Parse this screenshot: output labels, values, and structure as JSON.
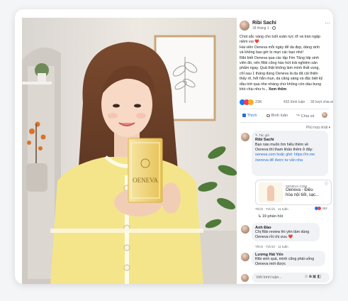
{
  "post": {
    "author": "Ribi Sachi",
    "meta": "18 tháng 1 · ",
    "caption_lines": [
      "Chút sắc vàng cho tuổi xuân rực rỡ và tràn ngập",
      "niềm vui ❤️",
      "Hai viên Oeneva mỗi ngày để da đẹp, dáng xinh",
      "và không bao giờ lo mụn các bạn nhé!",
      "Ribi biết Oeneva qua các tập Fim Tăng Idp sinh",
      "viên đó, nên Ribi cũng hào hứt trải nghiệm sản",
      "phẩm ngay. Quả thật không làm mình thất vọng,",
      "chỉ sau 1 tháng dùng Oeneva là da đã cải thiện",
      "thấy rõ, hết hẳn mụn, da căng sáng và đặc biệt kỹ",
      "dầu trời qua nhe nhàng chứ không còn dàu bung",
      "khó chịu như tr..."
    ],
    "see_more": "Xem thêm",
    "reaction_count": "23K",
    "comment_count": "432 bình luận",
    "share_count": "39 lượt chia sẻ",
    "actions": {
      "like": "Thích",
      "comment": "Bình luận",
      "share": "Chia sẻ"
    },
    "sort_label": "Phù hợp nhất",
    "product_brand": "OENEVA"
  },
  "comments": [
    {
      "author_tag": "Tác giả",
      "author": "Ribi Sachi",
      "lines": [
        "Bạn nào muốn tìm hiểu thêm về",
        "Oeneva thì tham khảo thêm ở đây:",
        "oeneva.com hoặc ghé: https://m.me",
        "/oeneva để được tư vấn nha"
      ],
      "link_card": {
        "domain": "OENEVA.COM",
        "title_lines": [
          "Oeneva - Điều",
          "hòa nội tiết, sạc..."
        ]
      },
      "actions": "Thích · Trả lời · 11 tuần",
      "reactions": "362",
      "replies": "19 phản hồi"
    },
    {
      "author": "Anh Đào",
      "lines": [
        "Chị Ribi review thì yên tâm dùng",
        "Oeneva rồi chị ưuu ❤️"
      ],
      "actions": "Thích · Trả lời · 11 tuần"
    },
    {
      "author": "Lương Hải Yến",
      "lines": [
        "Ribi xinh quá, mình cũng phải uống",
        "Oeneva mới được"
      ]
    }
  ],
  "composer": {
    "placeholder": "Viết bình luận..."
  },
  "colors": {
    "fb_blue": "#216fdb",
    "dress_yellow": "#f4e58a",
    "box_gold": "#e9c35a"
  }
}
